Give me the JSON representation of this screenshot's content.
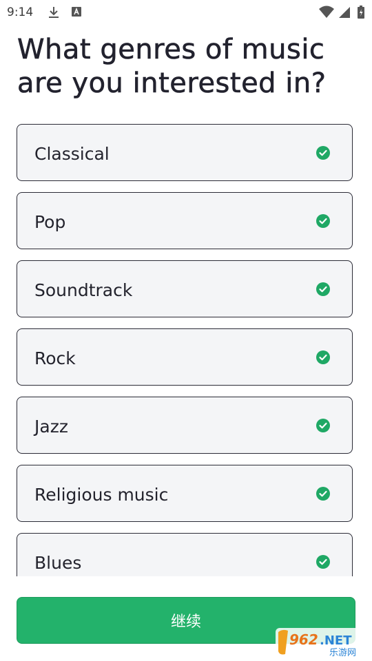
{
  "status_bar": {
    "time": "9:14",
    "icons": [
      "download-icon",
      "app-icon",
      "wifi-icon",
      "signal-icon",
      "battery-icon"
    ]
  },
  "title": "What genres of music are you interested in?",
  "genres": [
    {
      "label": "Classical",
      "selected": true
    },
    {
      "label": "Pop",
      "selected": true
    },
    {
      "label": "Soundtrack",
      "selected": true
    },
    {
      "label": "Rock",
      "selected": true
    },
    {
      "label": "Jazz",
      "selected": true
    },
    {
      "label": "Religious music",
      "selected": true
    },
    {
      "label": "Blues",
      "selected": true
    }
  ],
  "continue_label": "继续",
  "watermark": {
    "brand": "962.NET",
    "subtitle": "乐游网"
  },
  "colors": {
    "accent": "#23b26b",
    "check": "#1fa865",
    "card_bg": "#f4f5f7",
    "card_border": "#2a2a35"
  }
}
